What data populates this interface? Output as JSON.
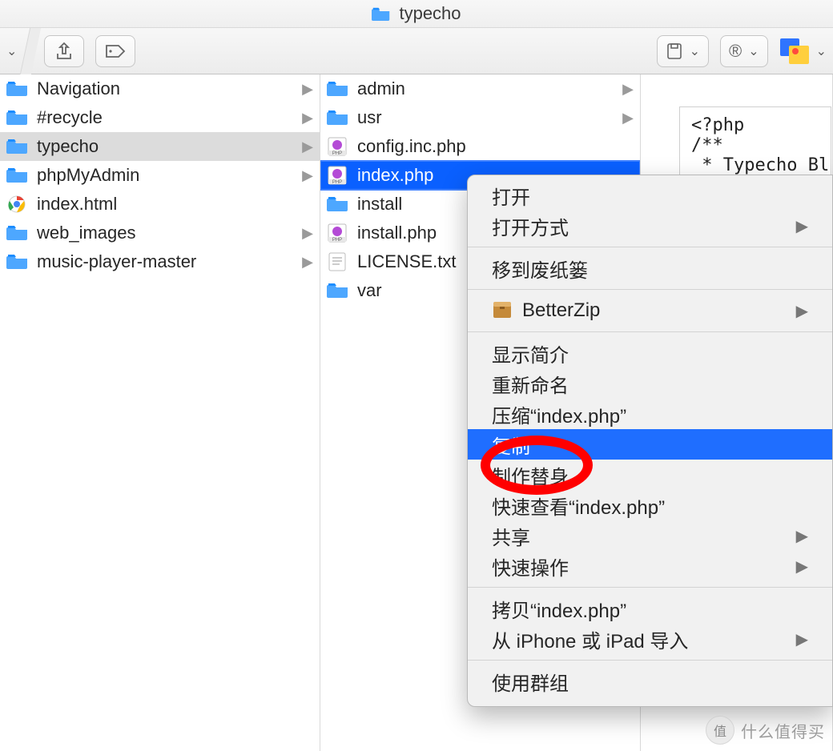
{
  "title": "typecho",
  "toolbar": {
    "archive_glyph": "⎘",
    "share_glyph": "⇪",
    "tag_glyph": "⌂"
  },
  "col1": [
    {
      "name": "Navigation",
      "type": "folder",
      "expandable": true
    },
    {
      "name": "#recycle",
      "type": "folder",
      "expandable": true
    },
    {
      "name": "typecho",
      "type": "folder",
      "expandable": true,
      "selected": "grey"
    },
    {
      "name": "phpMyAdmin",
      "type": "folder",
      "expandable": true
    },
    {
      "name": "index.html",
      "type": "chrome",
      "expandable": false
    },
    {
      "name": "web_images",
      "type": "folder",
      "expandable": true
    },
    {
      "name": "music-player-master",
      "type": "folder",
      "expandable": true
    }
  ],
  "col2": [
    {
      "name": "admin",
      "type": "folder",
      "expandable": true
    },
    {
      "name": "usr",
      "type": "folder",
      "expandable": true
    },
    {
      "name": "config.inc.php",
      "type": "php",
      "expandable": false
    },
    {
      "name": "index.php",
      "type": "php",
      "expandable": false,
      "selected": "blue"
    },
    {
      "name": "install",
      "type": "folder",
      "expandable": true
    },
    {
      "name": "install.php",
      "type": "php",
      "expandable": false
    },
    {
      "name": "LICENSE.txt",
      "type": "txt",
      "expandable": false
    },
    {
      "name": "var",
      "type": "folder",
      "expandable": true
    }
  ],
  "preview": {
    "line1": "<?php",
    "line2": "/**",
    "line3": " * Typecho Bl"
  },
  "context_menu": [
    {
      "label": "打开",
      "type": "item"
    },
    {
      "label": "打开方式",
      "type": "item",
      "sub": true
    },
    {
      "type": "sep"
    },
    {
      "label": "移到废纸篓",
      "type": "item"
    },
    {
      "type": "sep"
    },
    {
      "label": "BetterZip",
      "type": "item",
      "sub": true,
      "icon": "box"
    },
    {
      "type": "sep"
    },
    {
      "label": "显示简介",
      "type": "item"
    },
    {
      "label": "重新命名",
      "type": "item"
    },
    {
      "label": "压缩“index.php”",
      "type": "item"
    },
    {
      "label": "复制",
      "type": "item",
      "hl": true
    },
    {
      "label": "制作替身",
      "type": "item"
    },
    {
      "label": "快速查看“index.php”",
      "type": "item"
    },
    {
      "label": "共享",
      "type": "item",
      "sub": true
    },
    {
      "label": "快速操作",
      "type": "item",
      "sub": true
    },
    {
      "type": "sep"
    },
    {
      "label": "拷贝“index.php”",
      "type": "item"
    },
    {
      "label": "从 iPhone 或 iPad 导入",
      "type": "item",
      "sub": true
    },
    {
      "type": "sep"
    },
    {
      "label": "使用群组",
      "type": "item"
    }
  ],
  "watermark": {
    "glyph": "值",
    "text": "什么值得买"
  }
}
